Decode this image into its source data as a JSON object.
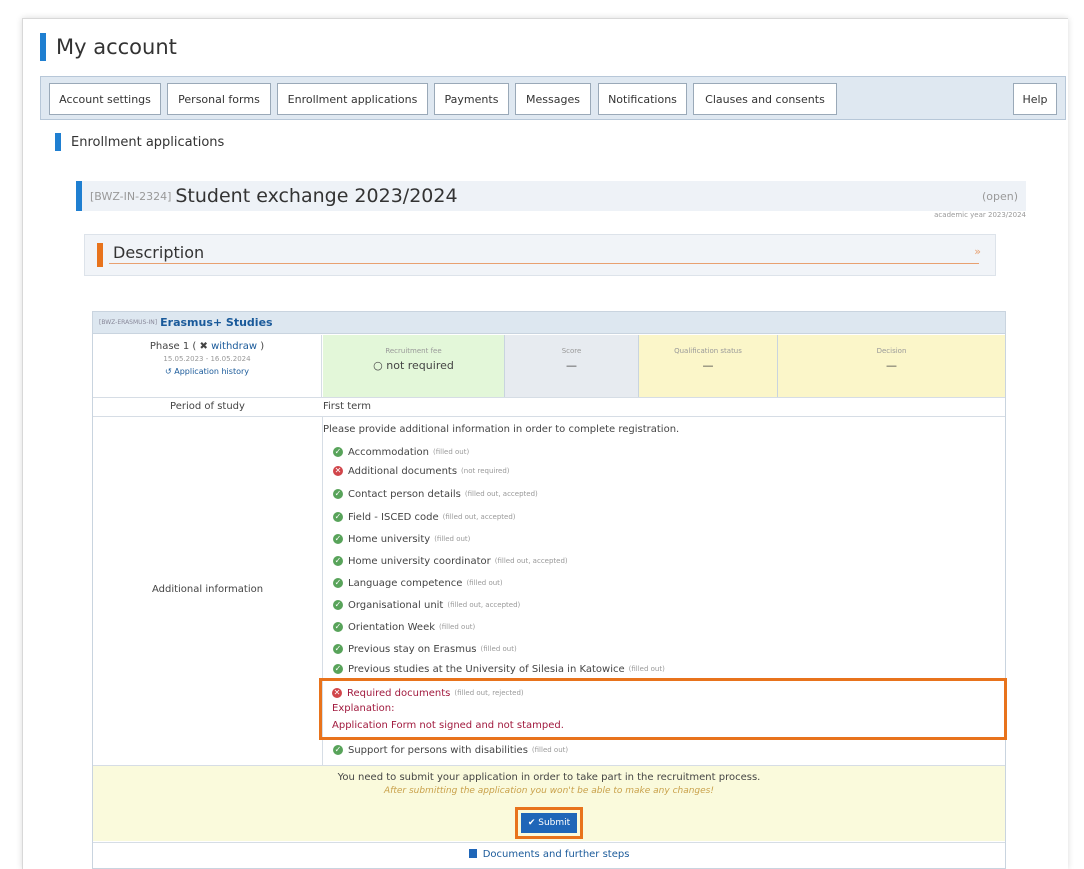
{
  "page": {
    "title": "My account"
  },
  "tabs": [
    {
      "label": "Account settings"
    },
    {
      "label": "Personal forms"
    },
    {
      "label": "Enrollment applications"
    },
    {
      "label": "Payments"
    },
    {
      "label": "Messages"
    },
    {
      "label": "Notifications"
    },
    {
      "label": "Clauses and consents"
    },
    {
      "label": "Help"
    }
  ],
  "section": {
    "title": "Enrollment applications"
  },
  "exchange": {
    "code": "[BWZ-IN-2324]",
    "title": "Student exchange 2023/2024",
    "status": "(open)",
    "academic_year": "academic year 2023/2024"
  },
  "description": {
    "title": "Description",
    "chevron": "»"
  },
  "table": {
    "code": "[BWZ-ERASMUS-IN]",
    "title": "Erasmus+ Studies",
    "phase": {
      "label": "Phase 1",
      "withdraw": "withdraw",
      "dates": "15.05.2023 - 16.05.2024",
      "history": "Application history"
    },
    "status_cells": {
      "fee_label": "Recruitment fee",
      "fee_value": "not required",
      "score_label": "Score",
      "score_value": "—",
      "qual_label": "Qualification status",
      "qual_value": "—",
      "decision_label": "Decision",
      "decision_value": "—"
    },
    "period_label": "Period of study",
    "period_value": "First term",
    "addl_label": "Additional information",
    "instruction": "Please provide additional information in order to complete registration.",
    "items": [
      {
        "name": "Accommodation",
        "status": "(filled out)",
        "icon": "ok"
      },
      {
        "name": "Additional documents",
        "status": "(not required)",
        "icon": "bad"
      },
      {
        "name": "Contact person details",
        "status": "(filled out, accepted)",
        "icon": "ok"
      },
      {
        "name": "Field - ISCED code",
        "status": "(filled out, accepted)",
        "icon": "ok"
      },
      {
        "name": "Home university",
        "status": "(filled out)",
        "icon": "ok"
      },
      {
        "name": "Home university coordinator",
        "status": "(filled out, accepted)",
        "icon": "ok"
      },
      {
        "name": "Language competence",
        "status": "(filled out)",
        "icon": "ok"
      },
      {
        "name": "Organisational unit",
        "status": "(filled out, accepted)",
        "icon": "ok"
      },
      {
        "name": "Orientation Week",
        "status": "(filled out)",
        "icon": "ok"
      },
      {
        "name": "Previous stay on Erasmus",
        "status": "(filled out)",
        "icon": "ok"
      },
      {
        "name": "Previous studies at the University of Silesia in Katowice",
        "status": "(filled out)",
        "icon": "ok"
      }
    ],
    "required": {
      "name": "Required documents",
      "status": "(filled out, rejected)",
      "explanation_label": "Explanation:",
      "explanation_text": "Application Form not signed and not stamped."
    },
    "support": {
      "name": "Support for persons with disabilities",
      "status": "(filled out)"
    },
    "submit_msg": "You need to submit your application in order to take part in the recruitment process.",
    "submit_warning": "After submitting the application you won't be able to make any changes!",
    "submit_label": "✔ Submit",
    "docs_link": "Documents and further steps"
  },
  "colors": {
    "accent": "#1f7fd1",
    "highlight": "#e8731c",
    "ok": "#58a35a",
    "error": "#d1454a"
  }
}
